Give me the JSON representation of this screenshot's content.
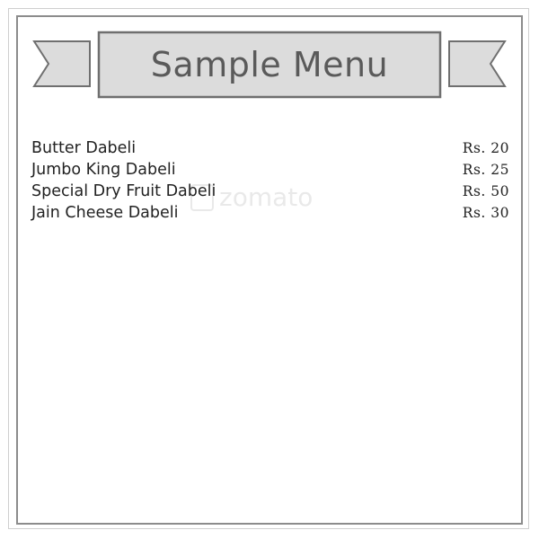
{
  "menu": {
    "title": "Sample Menu",
    "items": [
      {
        "name": "Butter Dabeli",
        "price": "Rs. 20"
      },
      {
        "name": "Jumbo King Dabeli",
        "price": "Rs. 25"
      },
      {
        "name": "Special Dry Fruit Dabeli",
        "price": "Rs. 50"
      },
      {
        "name": "Jain Cheese Dabeli",
        "price": "Rs. 30"
      }
    ]
  },
  "watermark": {
    "text": "zomato"
  },
  "colors": {
    "ribbon_fill": "#dcdcdc",
    "ribbon_stroke": "#6f6f6f",
    "frame": "#8c8c8c",
    "text": "#222222"
  }
}
